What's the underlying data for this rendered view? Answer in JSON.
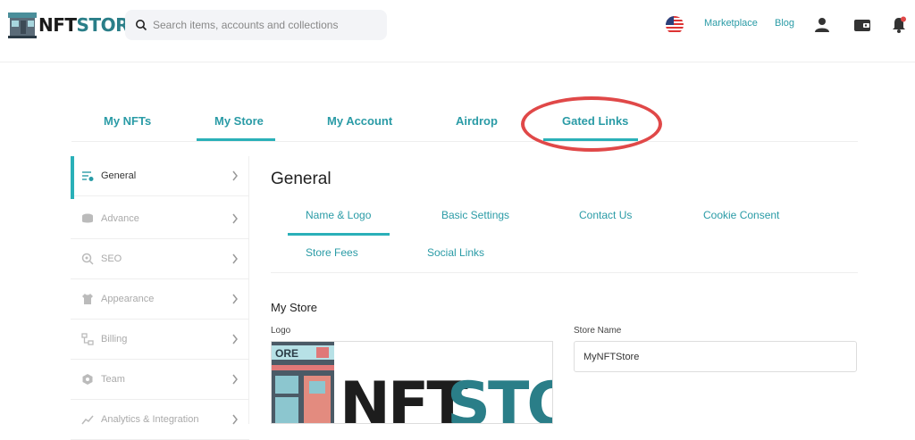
{
  "header": {
    "logo_text_nft": "NFT",
    "logo_text_store": "STORE",
    "search_placeholder": "Search items, accounts and collections",
    "links": {
      "marketplace": "Marketplace",
      "blog": "Blog"
    }
  },
  "tabs": [
    {
      "label": "My NFTs",
      "active": false
    },
    {
      "label": "My Store",
      "active": true
    },
    {
      "label": "My Account",
      "active": false
    },
    {
      "label": "Airdrop",
      "active": false
    },
    {
      "label": "Gated Links",
      "active": false,
      "highlighted": true
    }
  ],
  "sidebar": {
    "items": [
      {
        "label": "General",
        "icon": "general-settings-icon",
        "active": true
      },
      {
        "label": "Advance",
        "icon": "database-icon",
        "active": false
      },
      {
        "label": "SEO",
        "icon": "seo-search-icon",
        "active": false
      },
      {
        "label": "Appearance",
        "icon": "shirt-icon",
        "active": false
      },
      {
        "label": "Billing",
        "icon": "billing-icon",
        "active": false
      },
      {
        "label": "Team",
        "icon": "team-icon",
        "active": false
      },
      {
        "label": "Analytics & Integration",
        "icon": "analytics-icon",
        "active": false
      }
    ]
  },
  "main": {
    "title": "General",
    "subtabs": [
      {
        "label": "Name & Logo",
        "active": true
      },
      {
        "label": "Basic Settings",
        "active": false
      },
      {
        "label": "Contact Us",
        "active": false
      },
      {
        "label": "Cookie Consent",
        "active": false
      },
      {
        "label": "Store Fees",
        "active": false
      },
      {
        "label": "Social Links",
        "active": false
      }
    ],
    "section_title": "My Store",
    "logo_label": "Logo",
    "logo_preview_text_nft": "NFT",
    "logo_preview_text_store": "STOR",
    "logo_preview_sign": "ORE",
    "store_name_label": "Store Name",
    "store_name_value": "MyNFTStore"
  },
  "colors": {
    "accent": "#2ab0b8",
    "accent_text": "#2a9ba6",
    "highlight_oval": "#e04848"
  }
}
